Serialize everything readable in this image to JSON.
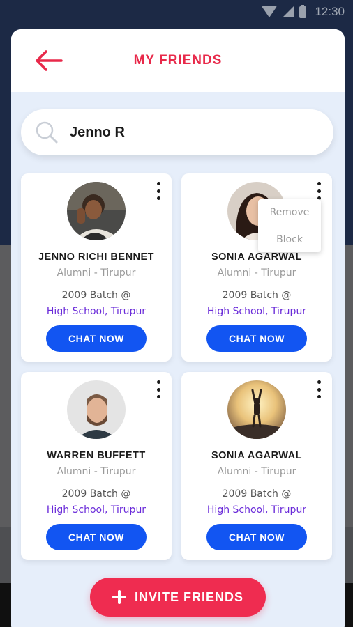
{
  "status_bar": {
    "time": "12:30"
  },
  "header": {
    "title": "MY FRIENDS"
  },
  "search": {
    "value": "Jenno R"
  },
  "friends": [
    {
      "name": "JENNO RICHI BENNET",
      "subtitle": "Alumni - Tirupur",
      "batch": "2009 Batch @",
      "school": "High School, Tirupur",
      "chat_label": "CHAT NOW"
    },
    {
      "name": "SONIA AGARWAL",
      "subtitle": "Alumni - Tirupur",
      "batch": "2009 Batch @",
      "school": "High School, Tirupur",
      "chat_label": "CHAT NOW"
    },
    {
      "name": "WARREN BUFFETT",
      "subtitle": "Alumni - Tirupur",
      "batch": "2009 Batch @",
      "school": "High School, Tirupur",
      "chat_label": "CHAT NOW"
    },
    {
      "name": "SONIA AGARWAL",
      "subtitle": "Alumni - Tirupur",
      "batch": "2009 Batch @",
      "school": "High School, Tirupur",
      "chat_label": "CHAT NOW"
    }
  ],
  "context_menu": {
    "items": [
      "Remove",
      "Block"
    ]
  },
  "invite": {
    "label": "INVITE FRIENDS"
  },
  "colors": {
    "accent_red": "#e8294a",
    "chat_blue": "#1255f2",
    "school_purple": "#6a2bd9",
    "sheet_bg": "#e6eefa"
  }
}
